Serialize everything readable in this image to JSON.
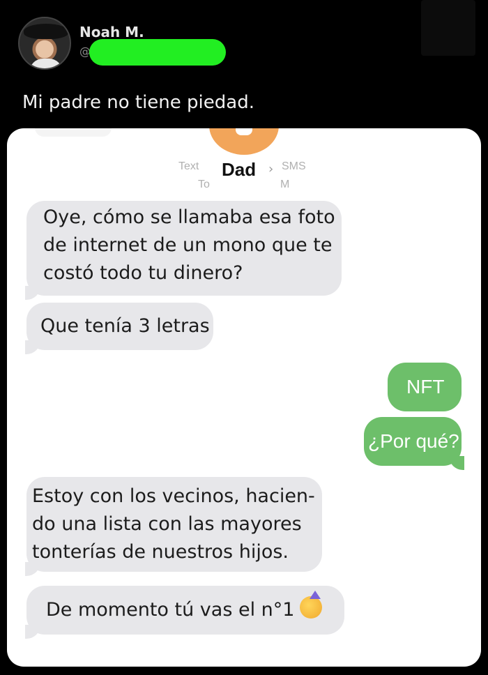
{
  "tweet": {
    "author_name": "Noah M.",
    "handle_prefix": "@",
    "text": "Mi padre no tiene piedad."
  },
  "colors": {
    "background": "#000000",
    "redaction": "#22ee22",
    "incoming_bubble": "#e7e7ea",
    "outgoing_bubble": "#6dbf6a",
    "contact_avatar": "#f2a55a"
  },
  "conversation": {
    "contact_name": "Dad",
    "chevron": "›",
    "header_left_fragment": "Text",
    "header_right_fragment": "SMS",
    "subheader_left_fragment": "To",
    "subheader_right_fragment": "M",
    "messages": [
      {
        "direction": "incoming",
        "text": "Oye, cómo se llamaba esa foto de internet de un mono que te costó todo tu dinero?"
      },
      {
        "direction": "incoming",
        "text": "Que tenía 3 letras"
      },
      {
        "direction": "outgoing",
        "text": "NFT"
      },
      {
        "direction": "outgoing",
        "text": "¿Por qué?"
      },
      {
        "direction": "incoming",
        "text": "Estoy con los vecinos, hacien-do una lista con las mayores tonterías de nuestros hijos."
      },
      {
        "direction": "incoming",
        "text": "De momento tú vas el n°1",
        "emoji": "partying-face-icon"
      }
    ]
  }
}
